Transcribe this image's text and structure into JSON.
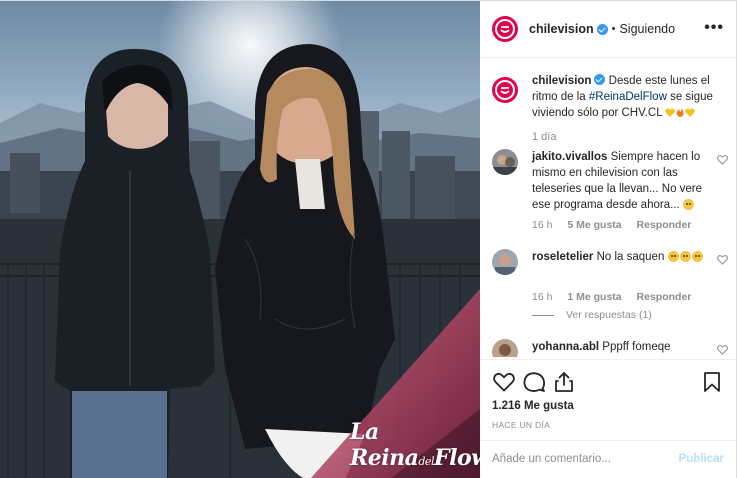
{
  "colors": {
    "brand": "#e4004f",
    "verified": "#3897f0",
    "link": "#003569",
    "muted": "#8e8e8e",
    "publish_disabled": "#b2dffc"
  },
  "photo": {
    "logo_text_main": "La Reina",
    "logo_text_small": "del",
    "logo_text_end": "Flow"
  },
  "header": {
    "username": "chilevision",
    "dot": "•",
    "follow_state": "Siguiendo",
    "more": "•••"
  },
  "caption": {
    "username": "chilevision",
    "text_before": " Desde este lunes el ritmo de la ",
    "hashtag": "#ReinaDelFlow",
    "text_after": " se sigue viviendo sólo por CHV.CL ",
    "time": "1 día"
  },
  "comments": [
    {
      "username": "jakito.vivallos",
      "text": " Siempre hacen lo mismo en chilevision con las teleseries que la llevan... No vere ese programa desde ahora... ",
      "time": "16 h",
      "likes": "5 Me gusta",
      "reply": "Responder"
    },
    {
      "username": "roseletelier",
      "text": " No la saquen ",
      "time": "16 h",
      "likes": "1 Me gusta",
      "reply": "Responder",
      "view_replies": "Ver respuestas (1)"
    },
    {
      "username": "yohanna.abl",
      "text": " Pppff fomeqe"
    }
  ],
  "actions": {
    "like_icon": "heart-icon",
    "comment_icon": "comment-icon",
    "share_icon": "share-icon",
    "save_icon": "bookmark-icon",
    "likes_count": "1.216 Me gusta",
    "ago": "HACE UN DÍA"
  },
  "add_comment": {
    "placeholder": "Añade un comentario...",
    "publish": "Publicar"
  }
}
